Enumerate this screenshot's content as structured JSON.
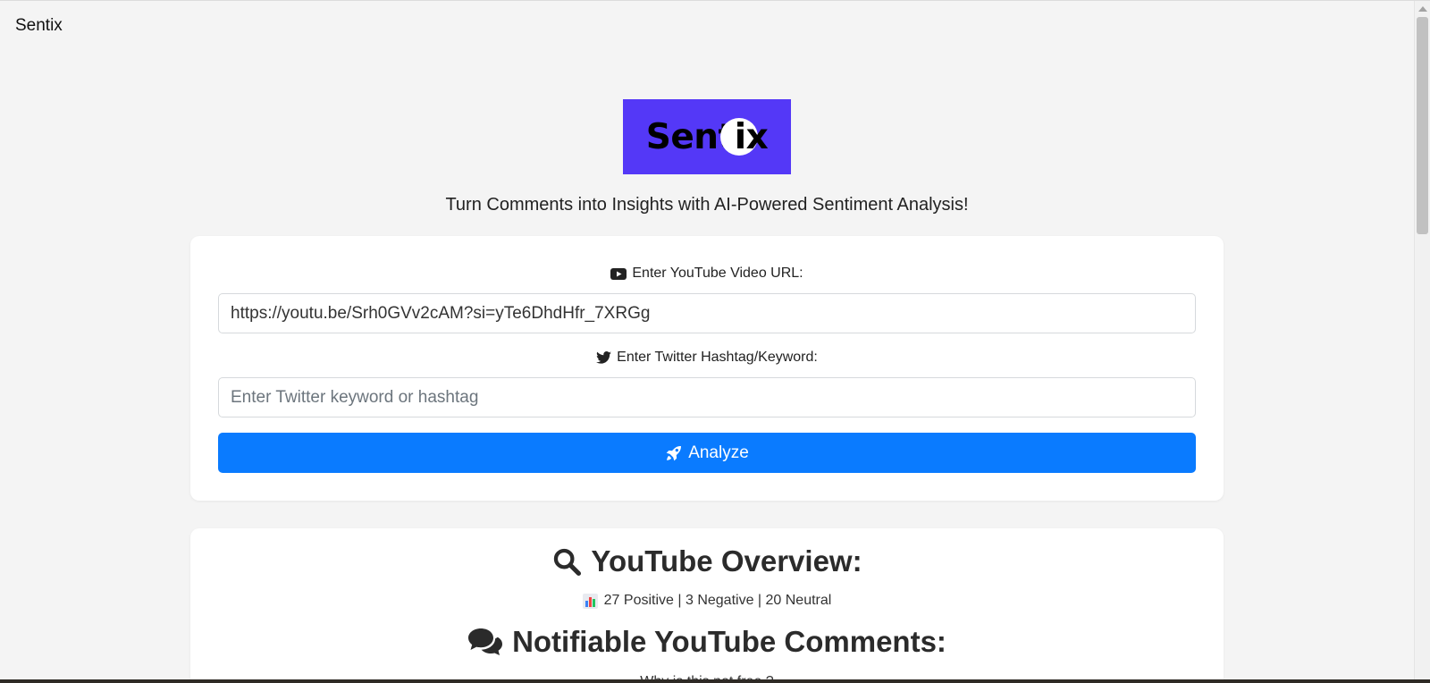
{
  "navbar": {
    "brand": "Sentix"
  },
  "logo": {
    "text_main": "Sent",
    "text_tail": "ix",
    "bg_color": "#5438f7"
  },
  "tagline": "Turn Comments into Insights with AI-Powered Sentiment Analysis!",
  "form": {
    "youtube_label": "Enter YouTube Video URL:",
    "youtube_value": "https://youtu.be/Srh0GVv2cAM?si=yTe6DhdHfr_7XRGg",
    "twitter_label": "Enter Twitter Hashtag/Keyword:",
    "twitter_placeholder": "Enter Twitter keyword or hashtag",
    "twitter_value": "",
    "analyze_label": "Analyze",
    "button_color": "#0a7bff"
  },
  "results": {
    "overview_title": "YouTube Overview:",
    "stats_text": "27 Positive | 3 Negative | 20 Neutral",
    "comments_title": "Notifiable YouTube Comments:",
    "first_comment": "Why is this not free ?"
  },
  "icons": {
    "youtube": "youtube-icon",
    "twitter": "twitter-icon",
    "rocket": "rocket-icon",
    "search": "search-icon",
    "chart": "bar-chart-icon",
    "comments": "comments-icon"
  }
}
